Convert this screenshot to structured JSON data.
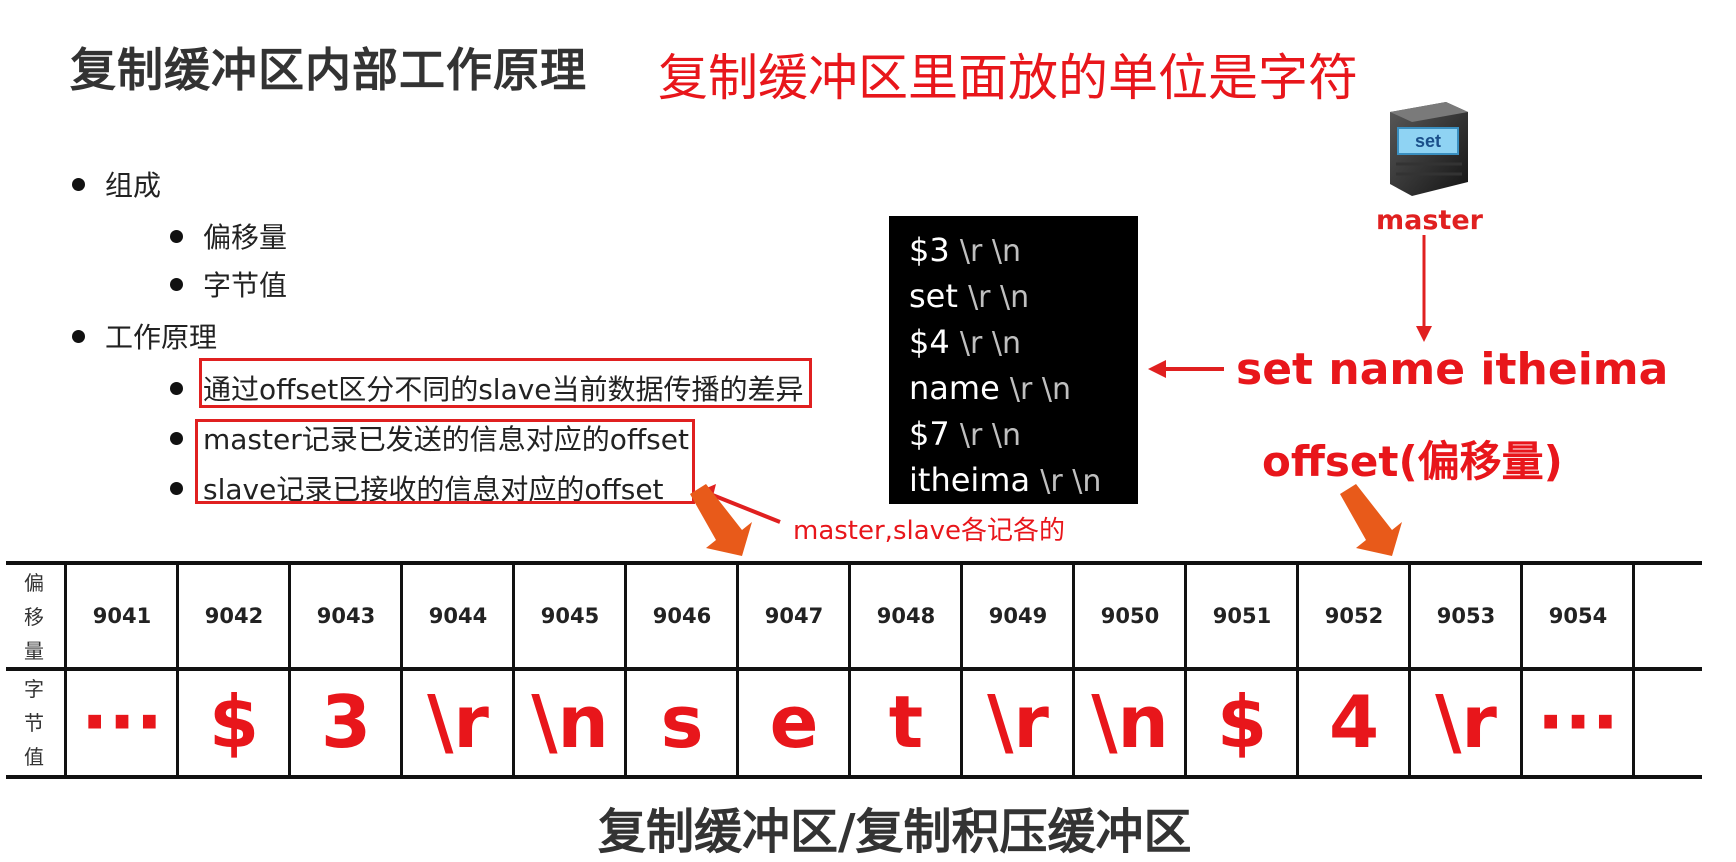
{
  "title": "复制缓冲区内部工作原理",
  "subtitle": "复制缓冲区里面放的单位是字符",
  "bullets": {
    "b1": "组成",
    "b1_1": "偏移量",
    "b1_2": "字节值",
    "b2": "工作原理",
    "b2_1": "通过offset区分不同的slave当前数据传播的差异",
    "b2_2": "master记录已发送的信息对应的offset",
    "b2_3": "slave记录已接收的信息对应的offset"
  },
  "terminal": {
    "lines": [
      "$3",
      "set",
      "$4",
      "name",
      "$7",
      "itheima"
    ],
    "escape": "\\r \\n"
  },
  "server": {
    "icon_label": "set",
    "label": "master"
  },
  "command": "set name itheima",
  "offset_label": "offset(偏移量)",
  "annotation": "master,slave各记各的",
  "table": {
    "row1_header": [
      "偏",
      "移",
      "量"
    ],
    "row2_header": [
      "字",
      "节",
      "值"
    ],
    "offsets": [
      "9041",
      "9042",
      "9043",
      "9044",
      "9045",
      "9046",
      "9047",
      "9048",
      "9049",
      "9050",
      "9051",
      "9052",
      "9053",
      "9054"
    ],
    "bytes": [
      "···",
      "$",
      "3",
      "\\r",
      "\\n",
      "s",
      "e",
      "t",
      "\\r",
      "\\n",
      "$",
      "4",
      "\\r",
      "···"
    ]
  },
  "footer": "复制缓冲区/复制积压缓冲区",
  "colors": {
    "accent_red": "#e8161b",
    "terminal_bg": "#000000"
  }
}
